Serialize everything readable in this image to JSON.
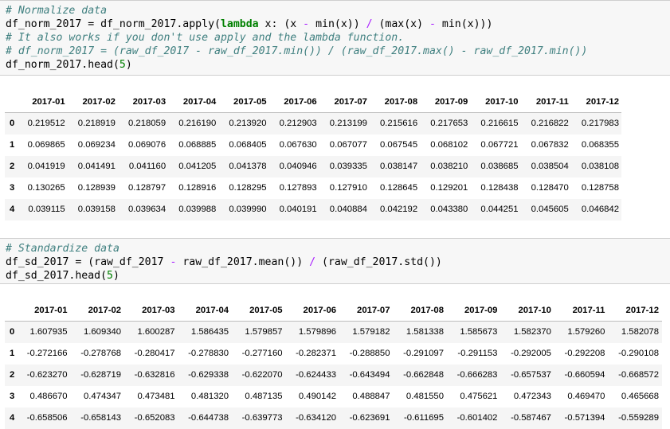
{
  "cell1": {
    "line1": "# Normalize data",
    "line2": {
      "a": "df_norm_2017 = df_norm_2017.apply(",
      "kw": "lambda",
      "b": " x: (x ",
      "op1": "-",
      "c": " min(x)) ",
      "op2": "/",
      "d": " (max(x) ",
      "op3": "-",
      "e": " min(x)))"
    },
    "line3": "# It also works if you don't use apply and the lambda function.",
    "line4": "# df_norm_2017 = (raw_df_2017 - raw_df_2017.min()) / (raw_df_2017.max() - raw_df_2017.min())",
    "line5": {
      "a": "df_norm_2017.head(",
      "num": "5",
      "b": ")"
    }
  },
  "cell2": {
    "line1": "# Standardize data",
    "line2": {
      "a": "df_sd_2017 = (raw_df_2017 ",
      "op1": "-",
      "b": " raw_df_2017.mean()) ",
      "op2": "/",
      "c": " (raw_df_2017.std())"
    },
    "line3": {
      "a": "df_sd_2017.head(",
      "num": "5",
      "b": ")"
    }
  },
  "table1": {
    "columns": [
      "2017-01",
      "2017-02",
      "2017-03",
      "2017-04",
      "2017-05",
      "2017-06",
      "2017-07",
      "2017-08",
      "2017-09",
      "2017-10",
      "2017-11",
      "2017-12"
    ],
    "rows": [
      {
        "index": "0",
        "values": [
          "0.219512",
          "0.218919",
          "0.218059",
          "0.216190",
          "0.213920",
          "0.212903",
          "0.213199",
          "0.215616",
          "0.217653",
          "0.216615",
          "0.216822",
          "0.217983"
        ]
      },
      {
        "index": "1",
        "values": [
          "0.069865",
          "0.069234",
          "0.069076",
          "0.068885",
          "0.068405",
          "0.067630",
          "0.067077",
          "0.067545",
          "0.068102",
          "0.067721",
          "0.067832",
          "0.068355"
        ]
      },
      {
        "index": "2",
        "values": [
          "0.041919",
          "0.041491",
          "0.041160",
          "0.041205",
          "0.041378",
          "0.040946",
          "0.039335",
          "0.038147",
          "0.038210",
          "0.038685",
          "0.038504",
          "0.038108"
        ]
      },
      {
        "index": "3",
        "values": [
          "0.130265",
          "0.128939",
          "0.128797",
          "0.128916",
          "0.128295",
          "0.127893",
          "0.127910",
          "0.128645",
          "0.129201",
          "0.128438",
          "0.128470",
          "0.128758"
        ]
      },
      {
        "index": "4",
        "values": [
          "0.039115",
          "0.039158",
          "0.039634",
          "0.039988",
          "0.039990",
          "0.040191",
          "0.040884",
          "0.042192",
          "0.043380",
          "0.044251",
          "0.045605",
          "0.046842"
        ]
      }
    ]
  },
  "table2": {
    "columns": [
      "2017-01",
      "2017-02",
      "2017-03",
      "2017-04",
      "2017-05",
      "2017-06",
      "2017-07",
      "2017-08",
      "2017-09",
      "2017-10",
      "2017-11",
      "2017-12"
    ],
    "rows": [
      {
        "index": "0",
        "values": [
          "1.607935",
          "1.609340",
          "1.600287",
          "1.586435",
          "1.579857",
          "1.579896",
          "1.579182",
          "1.581338",
          "1.585673",
          "1.582370",
          "1.579260",
          "1.582078"
        ]
      },
      {
        "index": "1",
        "values": [
          "-0.272166",
          "-0.278768",
          "-0.280417",
          "-0.278830",
          "-0.277160",
          "-0.282371",
          "-0.288850",
          "-0.291097",
          "-0.291153",
          "-0.292005",
          "-0.292208",
          "-0.290108"
        ]
      },
      {
        "index": "2",
        "values": [
          "-0.623270",
          "-0.628719",
          "-0.632816",
          "-0.629338",
          "-0.622070",
          "-0.624433",
          "-0.643494",
          "-0.662848",
          "-0.666283",
          "-0.657537",
          "-0.660594",
          "-0.668572"
        ]
      },
      {
        "index": "3",
        "values": [
          "0.486670",
          "0.474347",
          "0.473481",
          "0.481320",
          "0.487135",
          "0.490142",
          "0.488847",
          "0.481550",
          "0.475621",
          "0.472343",
          "0.469470",
          "0.465668"
        ]
      },
      {
        "index": "4",
        "values": [
          "-0.658506",
          "-0.658143",
          "-0.652083",
          "-0.644738",
          "-0.639773",
          "-0.634120",
          "-0.623691",
          "-0.611695",
          "-0.601402",
          "-0.587467",
          "-0.571394",
          "-0.559289"
        ]
      }
    ]
  }
}
